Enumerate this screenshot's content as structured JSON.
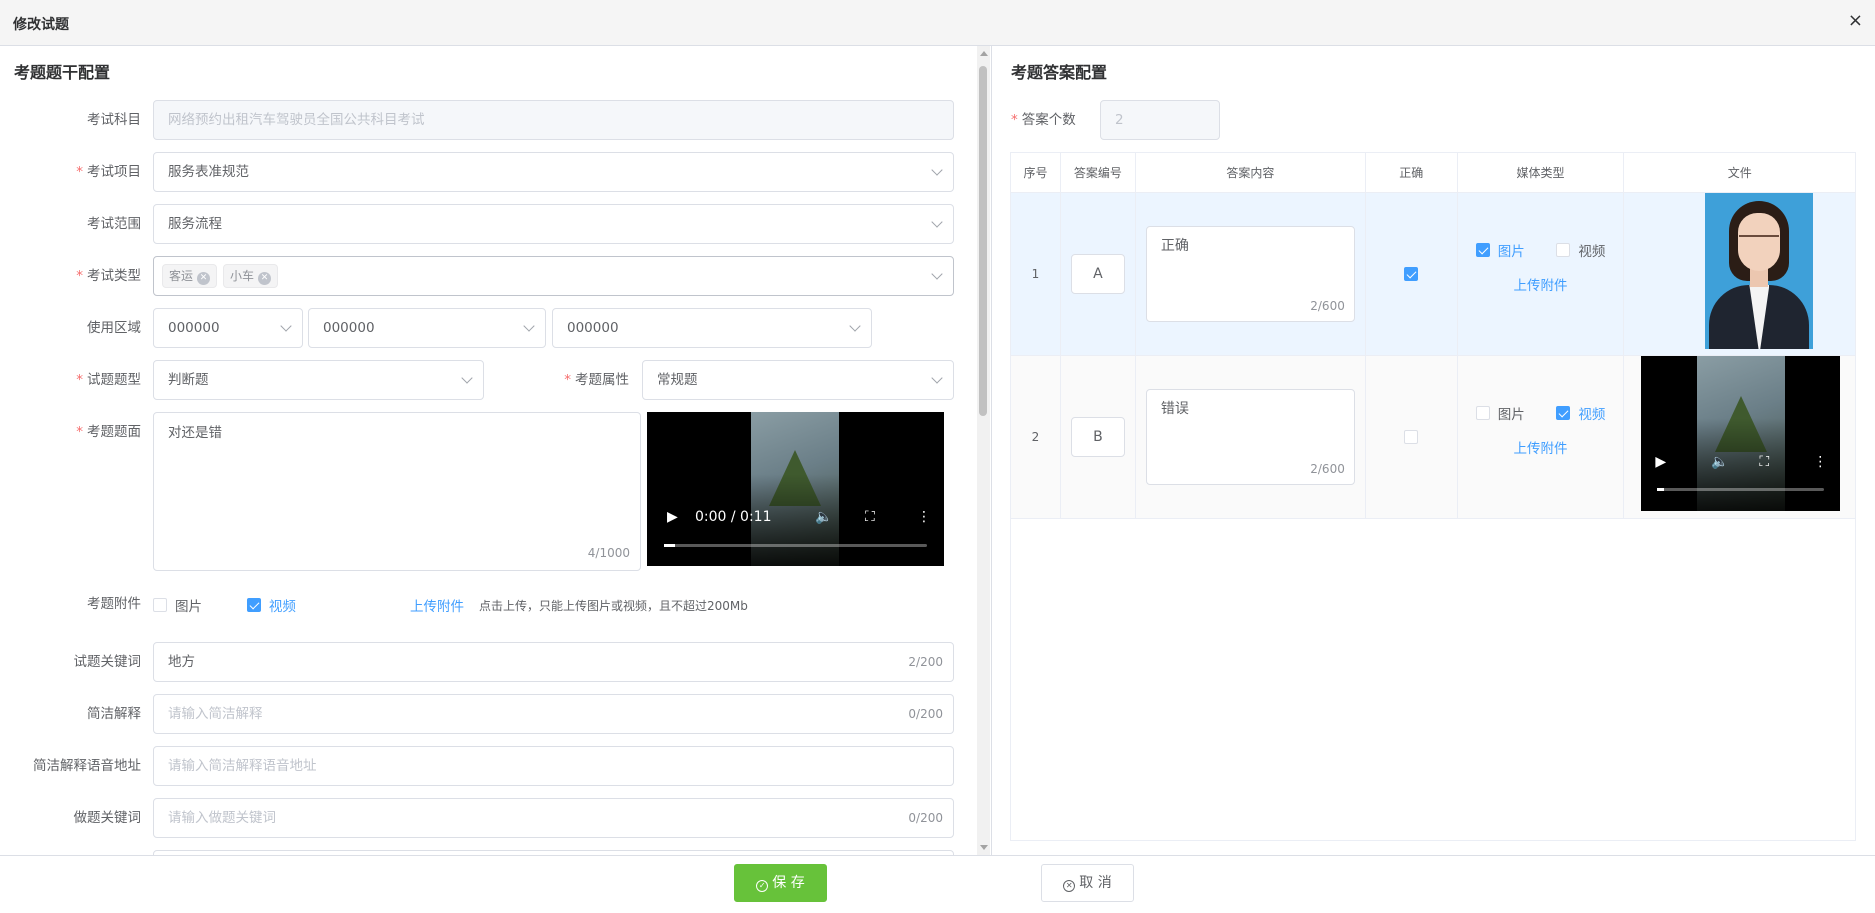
{
  "dialog": {
    "title": "修改试题",
    "close_glyph": "×"
  },
  "left": {
    "section_title": "考题题干配置",
    "subject": {
      "label": "考试科目",
      "value": "网络预约出租汽车驾驶员全国公共科目考试"
    },
    "project": {
      "label": "考试项目",
      "value": "服务表准规范"
    },
    "scope": {
      "label": "考试范围",
      "value": "服务流程"
    },
    "type": {
      "label": "考试类型",
      "tags": [
        "客运",
        "小车"
      ]
    },
    "region": {
      "label": "使用区域",
      "values": [
        "000000",
        "000000",
        "000000"
      ]
    },
    "question_type": {
      "label": "试题题型",
      "value": "判断题"
    },
    "attribute": {
      "label": "考题属性",
      "value": "常规题"
    },
    "stem": {
      "label": "考题题面",
      "value": "对还是错",
      "count": "4/1000",
      "video": {
        "time": "0:00 / 0:11",
        "progress": 0.04
      }
    },
    "attachment": {
      "label": "考题附件",
      "image_label": "图片",
      "image_checked": false,
      "video_label": "视频",
      "video_checked": true,
      "upload_link": "上传附件",
      "hint": "点击上传，只能上传图片或视频，且不超过200Mb"
    },
    "keywords": {
      "label": "试题关键词",
      "value": "地方",
      "count": "2/200"
    },
    "brief": {
      "label": "简洁解释",
      "placeholder": "请输入简洁解释",
      "count": "0/200"
    },
    "brief_audio": {
      "label": "简洁解释语音地址",
      "placeholder": "请输入简洁解释语音地址"
    },
    "do_keywords": {
      "label": "做题关键词",
      "placeholder": "请输入做题关键词",
      "count": "0/200"
    }
  },
  "right": {
    "section_title": "考题答案配置",
    "count": {
      "label": "答案个数",
      "value": "2"
    },
    "columns": [
      "序号",
      "答案编号",
      "答案内容",
      "正确",
      "媒体类型",
      "文件"
    ],
    "rows": [
      {
        "index": "1",
        "code": "A",
        "content": "正确",
        "count": "2/600",
        "correct": true,
        "image_label": "图片",
        "image_checked": true,
        "video_label": "视频",
        "video_checked": false,
        "upload_link": "上传附件",
        "file": "photo"
      },
      {
        "index": "2",
        "code": "B",
        "content": "错误",
        "count": "2/600",
        "correct": false,
        "image_label": "图片",
        "image_checked": false,
        "video_label": "视频",
        "video_checked": true,
        "upload_link": "上传附件",
        "file": "video",
        "video_progress": 0.04
      }
    ]
  },
  "footer": {
    "save_label": "保 存",
    "cancel_label": "取 消"
  },
  "colors": {
    "primary": "#409eff",
    "success": "#67c23a",
    "danger": "#f56c6c"
  }
}
